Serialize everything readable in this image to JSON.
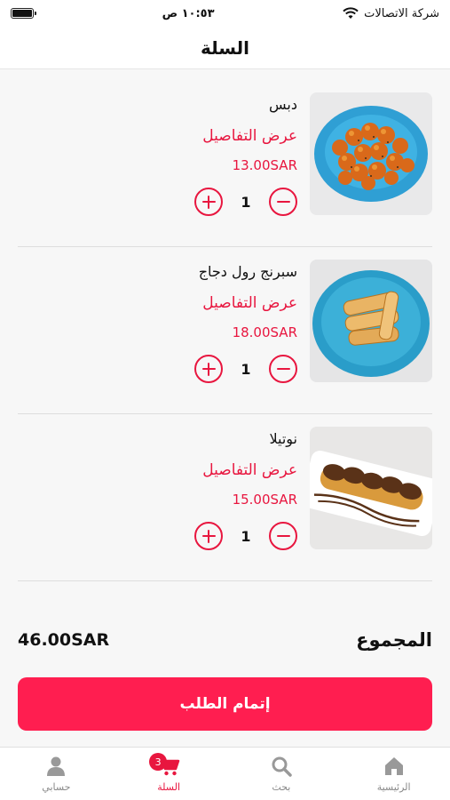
{
  "status_bar": {
    "carrier": "شركة الاتصالات",
    "time": "١٠:٥٣ ص"
  },
  "header": {
    "title": "السلة"
  },
  "cart": {
    "details_label": "عرض التفاصيل",
    "items": [
      {
        "name": "دبس",
        "price": "13.00SAR",
        "quantity": "1",
        "image": "fried-dough-balls"
      },
      {
        "name": "سبرنج رول دجاج",
        "price": "18.00SAR",
        "quantity": "1",
        "image": "spring-rolls"
      },
      {
        "name": "نوتيلا",
        "price": "15.00SAR",
        "quantity": "1",
        "image": "nutella-pastry"
      }
    ]
  },
  "summary": {
    "total_label": "المجموع",
    "total_value": "46.00SAR",
    "checkout_label": "إتمام الطلب"
  },
  "tab_bar": {
    "tabs": [
      {
        "label": "الرئيسية",
        "icon": "home-icon"
      },
      {
        "label": "بحث",
        "icon": "search-icon"
      },
      {
        "label": "السلة",
        "icon": "cart-icon",
        "badge": "3",
        "active": true
      },
      {
        "label": "حسابي",
        "icon": "user-icon"
      }
    ]
  },
  "colors": {
    "accent": "#e8163f",
    "button": "#ff1e50",
    "inactive": "#888888"
  }
}
